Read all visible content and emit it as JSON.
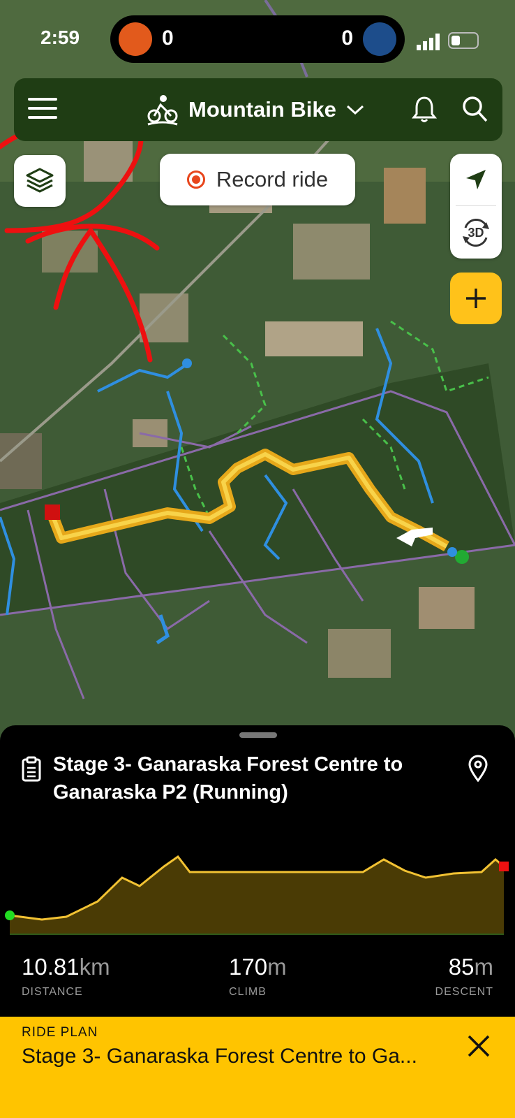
{
  "status": {
    "time": "2:59",
    "score_left": "0",
    "score_right": "0"
  },
  "header": {
    "activity_label": "Mountain Bike"
  },
  "map": {
    "record_label": "Record ride",
    "view_3d_label": "3D"
  },
  "route": {
    "title": "Stage 3- Ganaraska Forest Centre to Ganaraska P2 (Running)",
    "stats": [
      {
        "value": "10.81",
        "unit": "km",
        "label": "DISTANCE"
      },
      {
        "value": "170",
        "unit": "m",
        "label": "CLIMB"
      },
      {
        "value": "85",
        "unit": "m",
        "label": "DESCENT"
      }
    ]
  },
  "ride_plan": {
    "label": "RIDE PLAN",
    "name": "Stage 3- Ganaraska Forest Centre to Ga..."
  },
  "colors": {
    "accent": "#ffc400",
    "route": "#f6c22c",
    "start": "#22cc22",
    "end": "#dd1111"
  }
}
